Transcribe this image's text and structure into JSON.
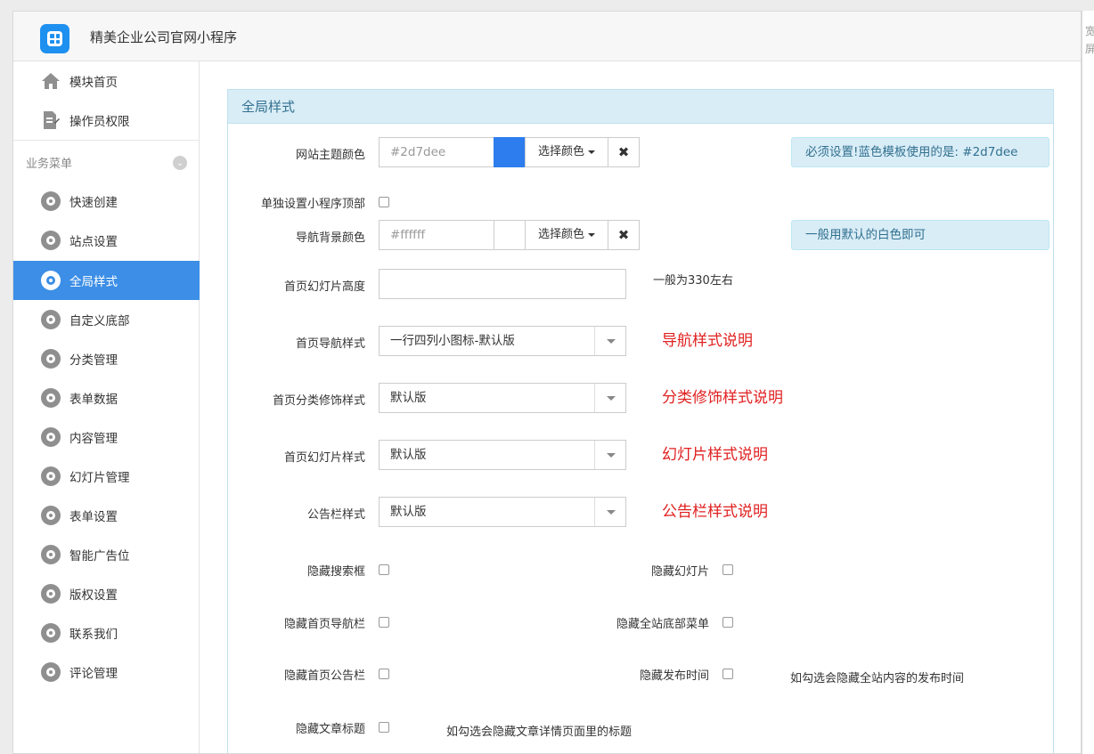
{
  "app": {
    "title": "精美企业公司官网小程序"
  },
  "right_strip": {
    "chars": [
      "宽",
      "屏"
    ]
  },
  "sidebar": {
    "top_items": [
      {
        "label": "模块首页",
        "icon": "home-icon"
      },
      {
        "label": "操作员权限",
        "icon": "edit-document-icon"
      }
    ],
    "section_title": "业务菜单",
    "section_toggle": "⌄",
    "items": [
      {
        "label": "快速创建",
        "icon": "gear-icon",
        "active": false
      },
      {
        "label": "站点设置",
        "icon": "gear-icon",
        "active": false
      },
      {
        "label": "全局样式",
        "icon": "gear-icon",
        "active": true
      },
      {
        "label": "自定义底部",
        "icon": "gear-icon",
        "active": false
      },
      {
        "label": "分类管理",
        "icon": "gear-icon",
        "active": false
      },
      {
        "label": "表单数据",
        "icon": "gear-icon",
        "active": false
      },
      {
        "label": "内容管理",
        "icon": "gear-icon",
        "active": false
      },
      {
        "label": "幻灯片管理",
        "icon": "gear-icon",
        "active": false
      },
      {
        "label": "表单设置",
        "icon": "gear-icon",
        "active": false
      },
      {
        "label": "智能广告位",
        "icon": "gear-icon",
        "active": false
      },
      {
        "label": "版权设置",
        "icon": "gear-icon",
        "active": false
      },
      {
        "label": "联系我们",
        "icon": "gear-icon",
        "active": false
      },
      {
        "label": "评论管理",
        "icon": "gear-icon",
        "active": false
      }
    ]
  },
  "panel": {
    "title": "全局样式",
    "theme_color": {
      "label": "网站主题颜色",
      "placeholder": "#2d7dee",
      "swatch": "#2d7dee",
      "pick_label": "选择颜色",
      "clear_label": "✖",
      "note": "必须设置!蓝色模板使用的是: #2d7dee"
    },
    "separate_top": {
      "label": "单独设置小程序顶部"
    },
    "nav_bg_color": {
      "label": "导航背景颜色",
      "placeholder": "#ffffff",
      "swatch": "#ffffff",
      "pick_label": "选择颜色",
      "clear_label": "✖",
      "note": "一般用默认的白色即可"
    },
    "slide_height": {
      "label": "首页幻灯片高度",
      "value": "",
      "help": "一般为330左右"
    },
    "nav_style": {
      "label": "首页导航样式",
      "value": "一行四列小图标-默认版",
      "help": "导航样式说明"
    },
    "cat_style": {
      "label": "首页分类修饰样式",
      "value": "默认版",
      "help": "分类修饰样式说明"
    },
    "slide_style": {
      "label": "首页幻灯片样式",
      "value": "默认版",
      "help": "幻灯片样式说明"
    },
    "notice_style": {
      "label": "公告栏样式",
      "value": "默认版",
      "help": "公告栏样式说明"
    },
    "hide_search": {
      "label": "隐藏搜索框"
    },
    "hide_slides": {
      "label": "隐藏幻灯片"
    },
    "hide_home_nav": {
      "label": "隐藏首页导航栏"
    },
    "hide_footer_menu": {
      "label": "隐藏全站底部菜单"
    },
    "hide_home_notice": {
      "label": "隐藏首页公告栏"
    },
    "hide_pub_time": {
      "label": "隐藏发布时间",
      "help": "如勾选会隐藏全站内容的发布时间"
    },
    "hide_article_title": {
      "label": "隐藏文章标题",
      "help": "如勾选会隐藏文章详情页面里的标题"
    }
  }
}
